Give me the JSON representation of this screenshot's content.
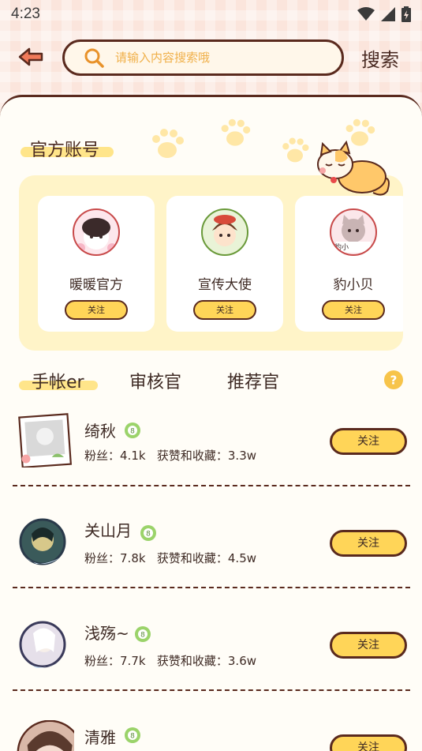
{
  "status_bar": {
    "time": "4:23"
  },
  "search": {
    "placeholder": "请输入内容搜索哦",
    "button_label": "搜索"
  },
  "official": {
    "title": "官方账号",
    "accounts": [
      {
        "name": "暖暖官方",
        "follow_label": "关注"
      },
      {
        "name": "宣传大使",
        "follow_label": "关注"
      },
      {
        "name": "豹小贝",
        "follow_label": "关注",
        "avatar_text": "豹小"
      }
    ]
  },
  "tabs": [
    {
      "label": "手帐er",
      "active": true
    },
    {
      "label": "审核官",
      "active": false
    },
    {
      "label": "推荐官",
      "active": false
    }
  ],
  "users": [
    {
      "name": "绮秋",
      "fans_label": "粉丝：",
      "fans": "4.1k",
      "likes_label": "获赞和收藏：",
      "likes": "3.3w",
      "follow_label": "关注"
    },
    {
      "name": "关山月",
      "fans_label": "粉丝：",
      "fans": "7.8k",
      "likes_label": "获赞和收藏：",
      "likes": "4.5w",
      "follow_label": "关注"
    },
    {
      "name": "浅殇~",
      "fans_label": "粉丝：",
      "fans": "7.7k",
      "likes_label": "获赞和收藏：",
      "likes": "3.6w",
      "follow_label": "关注"
    },
    {
      "name": "清雅",
      "follow_label": "关注"
    }
  ],
  "badge_text": "8",
  "help_text": "?",
  "colors": {
    "accent_yellow": "#ffd558",
    "outline_brown": "#5a2a1e",
    "panel_yellow": "#fff4c8",
    "badge_green": "#9bd36a"
  }
}
